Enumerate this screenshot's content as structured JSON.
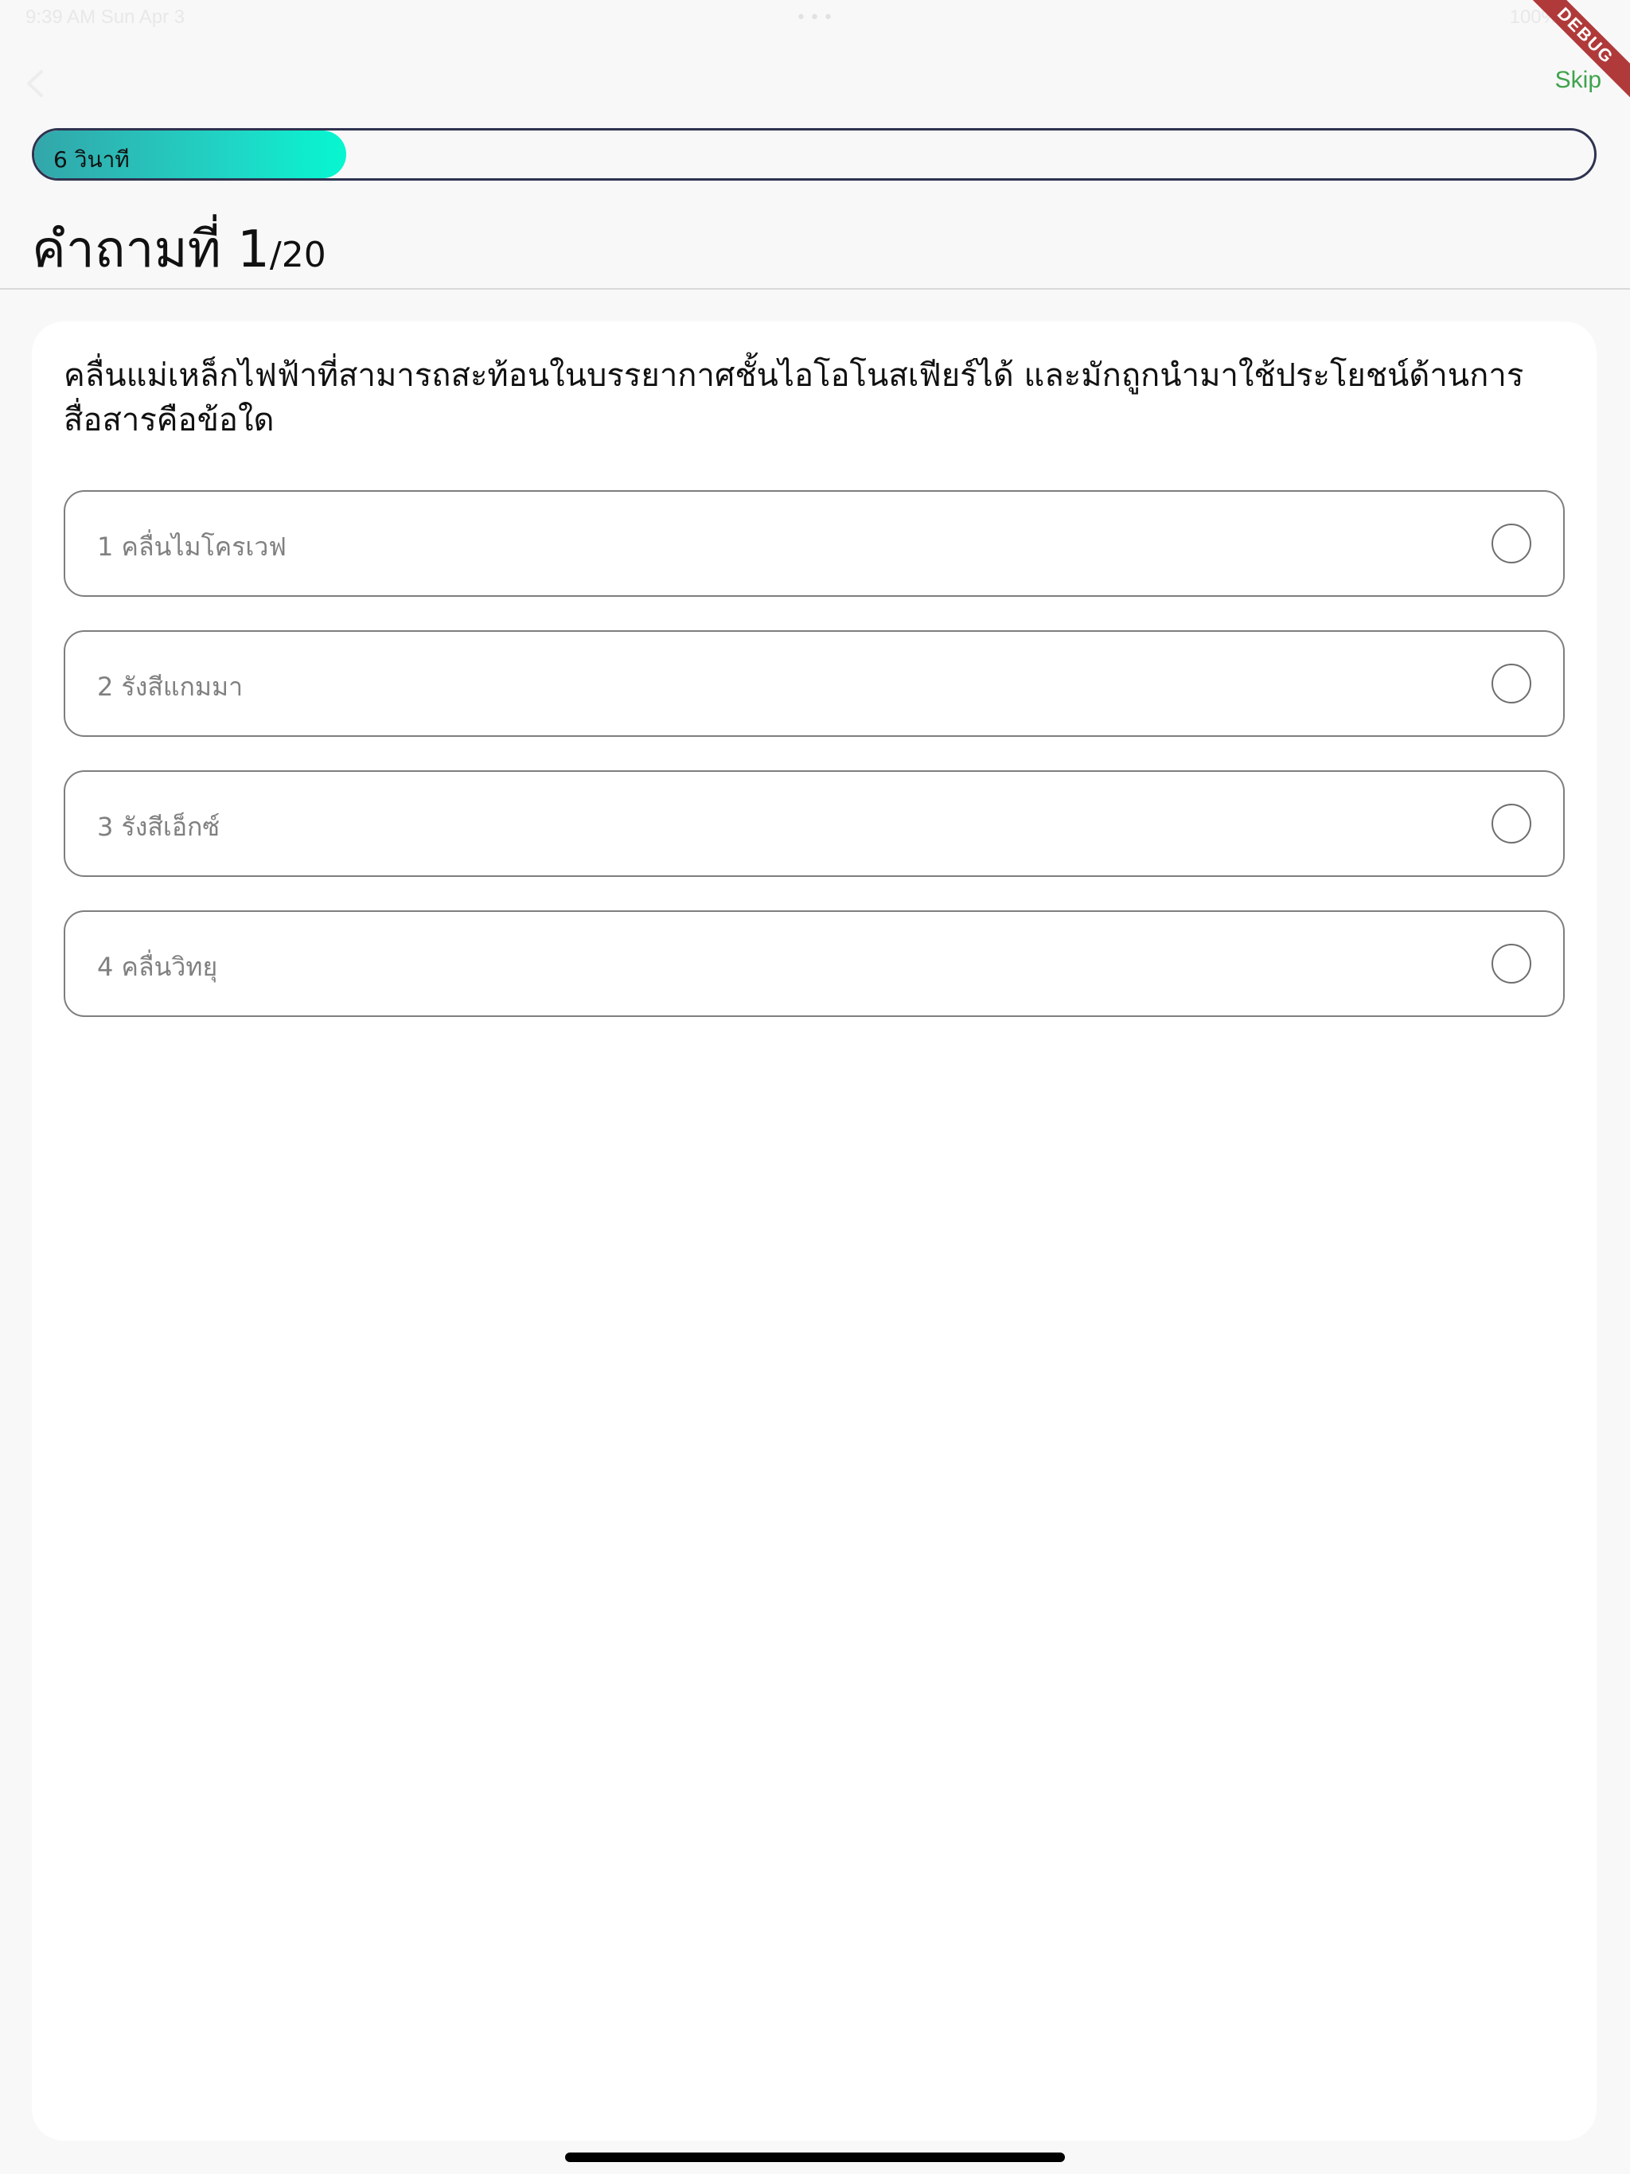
{
  "status_bar": {
    "time": "9:39 AM  Sun Apr 3",
    "battery": "100%",
    "dots": "•••"
  },
  "debug_banner": "DEBUG",
  "header": {
    "back_icon": "chevron-left-icon",
    "skip_label": "Skip"
  },
  "timer": {
    "label": "6 วินาที",
    "progress": 0.2
  },
  "question_counter": {
    "current": "คำถามที่ 1",
    "total": "/20"
  },
  "question": {
    "text": "คลื่นแม่เหล็กไฟฟ้าที่สามารถสะท้อนในบรรยากาศชั้นไอโอโนสเฟียร์ได้ และมักถูกนำมาใช้ประโยชน์ด้านการสื่อสารคือข้อใด",
    "options": [
      {
        "label": "1 คลื่นไมโครเวฟ",
        "selected": false
      },
      {
        "label": "2 รังสีแกมมา",
        "selected": false
      },
      {
        "label": "3 รังสีเอ็กซ์",
        "selected": false
      },
      {
        "label": "4 คลื่นวิทยุ",
        "selected": false
      }
    ]
  },
  "colors": {
    "accent_green": "#3fa34d",
    "timer_gradient_start": "#33a6aa",
    "timer_gradient_end": "#06f7d1",
    "timer_border": "#2f3350"
  }
}
